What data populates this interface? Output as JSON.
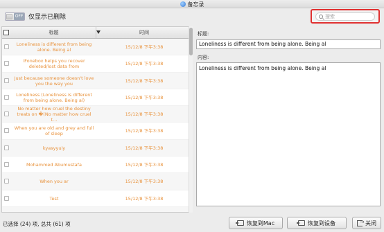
{
  "window": {
    "title": "备忘录",
    "icon": "notes-app-icon"
  },
  "toolbar": {
    "toggle_state": "OFF",
    "toggle_label": "仅显示已删除"
  },
  "search": {
    "placeholder": "搜索",
    "value": ""
  },
  "list": {
    "columns": {
      "title": "标题",
      "time": "时间"
    },
    "rows": [
      {
        "title": "Loneliness is different from being alone. Being al",
        "time": "15/12/8 下午3:38"
      },
      {
        "title": "iFonebox helps you recover deleted/lost data from",
        "time": "15/12/8 下午3:38"
      },
      {
        "title": "Just because someone doesn't love you the way you",
        "time": "15/12/8 下午3:38"
      },
      {
        "title": "Loneliness (Loneliness is different from being alone. Being al)",
        "time": "15/12/8 下午3:38"
      },
      {
        "title": "No matter how cruel the destiny treats on �(No matter how cruel t…",
        "time": "15/12/8 下午3:38"
      },
      {
        "title": "When you are old and grey and full of sleep",
        "time": "15/12/8 下午3:38"
      },
      {
        "title": "kyasyyuiy",
        "time": "15/12/8 下午3:38"
      },
      {
        "title": "Mohammed Abumustafa",
        "time": "15/12/8 下午3:38"
      },
      {
        "title": "When you ar",
        "time": "15/12/8 下午3:38"
      },
      {
        "title": "Test",
        "time": "15/12/8 下午3:38"
      },
      {
        "title": "",
        "time": ""
      }
    ]
  },
  "detail": {
    "title_label": "标题:",
    "title_value": "Loneliness is different from being alone. Being al",
    "content_label": "内容:",
    "content_value": "Loneliness is different from being alone. Being al"
  },
  "status": {
    "text": "已选择 (24) 项, 总共 (61) 项"
  },
  "buttons": {
    "restore_mac": "恢复到Mac",
    "restore_device": "恢复到设备",
    "close": "关闭"
  },
  "colors": {
    "accent_text": "#e8913a",
    "search_highlight": "#e03030"
  }
}
